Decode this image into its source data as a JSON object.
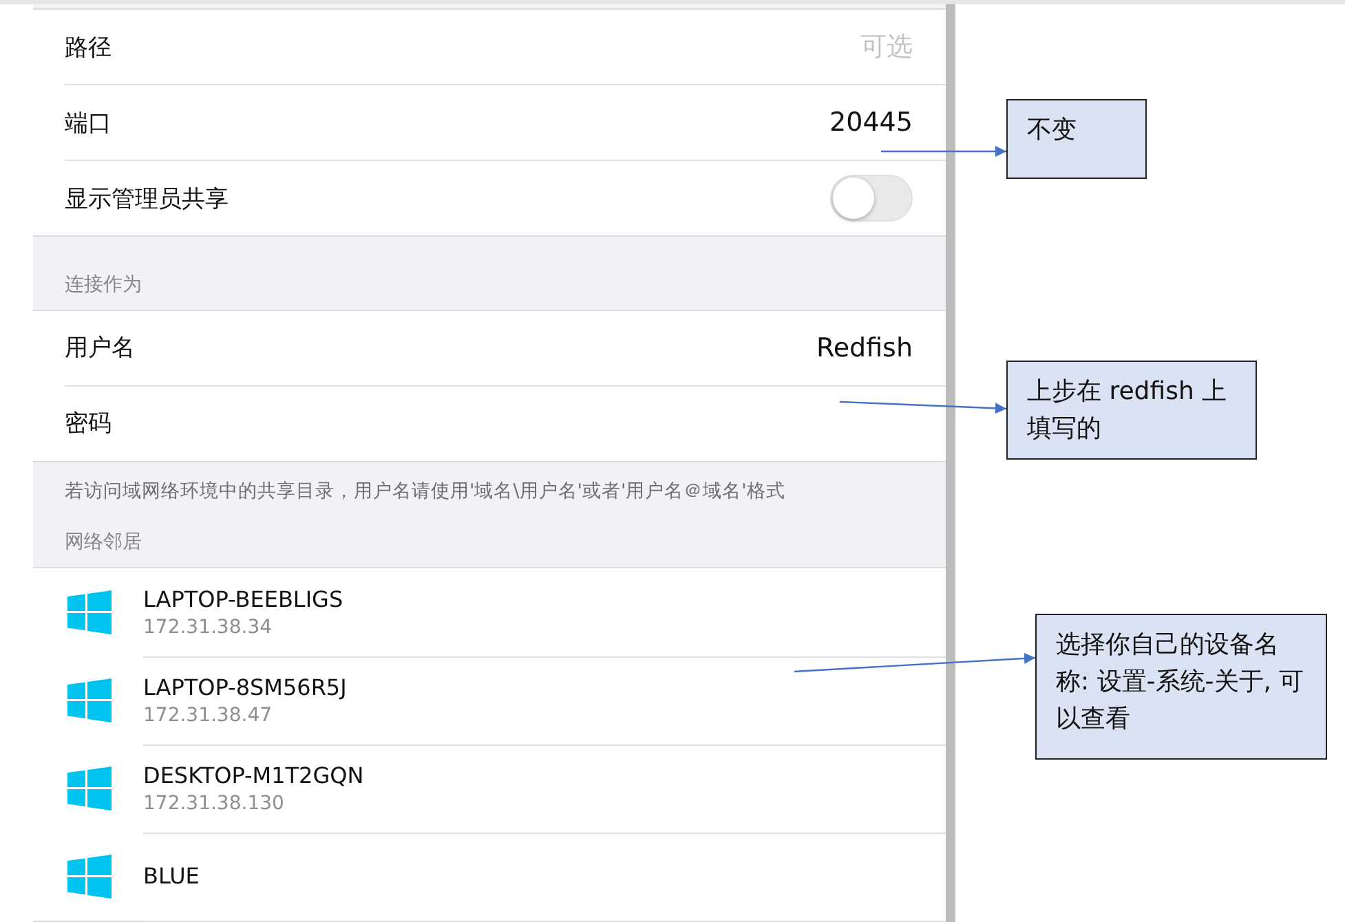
{
  "server_settings": {
    "rows": [
      {
        "kind": "field",
        "label": "路径",
        "placeholder": "可选"
      },
      {
        "kind": "field",
        "label": "端口",
        "value": "20445"
      },
      {
        "kind": "toggle",
        "label": "显示管理员共享",
        "on": false
      }
    ]
  },
  "connect_as": {
    "header": "连接作为",
    "rows": [
      {
        "kind": "field",
        "label": "用户名",
        "value": "Redfish"
      },
      {
        "kind": "field",
        "label": "密码"
      }
    ],
    "footer": "若访问域网络环境中的共享目录，用户名请使用'域名\\用户名'或者'用户名＠域名'格式"
  },
  "network_neighborhood": {
    "header": "网络邻居",
    "devices": [
      {
        "name": "LAPTOP-BEEBLIGS",
        "ip": "172.31.38.34"
      },
      {
        "name": "LAPTOP-8SM56R5J",
        "ip": "172.31.38.47"
      },
      {
        "name": "DESKTOP-M1T2GQN",
        "ip": "172.31.38.130"
      },
      {
        "name": "BLUE"
      }
    ]
  },
  "annotations": [
    {
      "text": "不变"
    },
    {
      "text": "上步在 redfish 上填写的"
    },
    {
      "text": "选择你自己的设备名称: 设置-系统-关于, 可以查看"
    }
  ]
}
